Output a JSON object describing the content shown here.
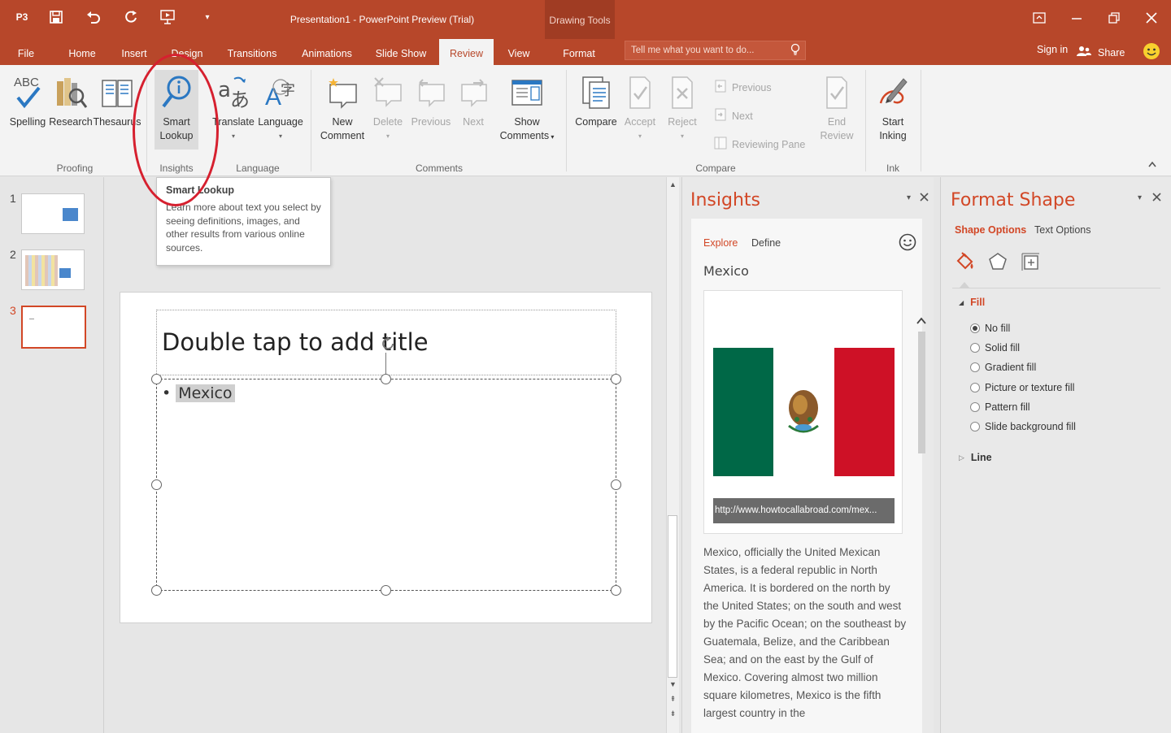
{
  "window": {
    "title": "Presentation1 - PowerPoint Preview (Trial)",
    "app_badge": "P3",
    "contextual_group": "Drawing Tools"
  },
  "tabs": [
    "File",
    "Home",
    "Insert",
    "Design",
    "Transitions",
    "Animations",
    "Slide Show",
    "Review",
    "View",
    "Format"
  ],
  "active_tab": "Review",
  "tell_me": {
    "placeholder": "Tell me what you want to do..."
  },
  "account": {
    "sign_in": "Sign in",
    "share": "Share"
  },
  "ribbon": {
    "proofing": {
      "label": "Proofing",
      "spelling": "Spelling",
      "research": "Research",
      "thesaurus": "Thesaurus",
      "abc": "ABC"
    },
    "insights": {
      "label": "Insights",
      "smart_lookup_line1": "Smart",
      "smart_lookup_line2": "Lookup"
    },
    "language": {
      "label": "Language",
      "translate": "Translate",
      "language": "Language"
    },
    "comments": {
      "label": "Comments",
      "new_line1": "New",
      "new_line2": "Comment",
      "delete": "Delete",
      "previous": "Previous",
      "next": "Next",
      "show_line1": "Show",
      "show_line2": "Comments"
    },
    "compare": {
      "label": "Compare",
      "compare": "Compare",
      "accept": "Accept",
      "reject": "Reject",
      "previous": "Previous",
      "next": "Next",
      "reviewing_pane": "Reviewing Pane",
      "end_line1": "End",
      "end_line2": "Review"
    },
    "ink": {
      "label": "Ink",
      "start_line1": "Start",
      "start_line2": "Inking"
    }
  },
  "tooltip": {
    "title": "Smart Lookup",
    "body": "Learn more about text you select by seeing definitions, images, and other results from various online sources."
  },
  "thumbnails": [
    {
      "num": "1"
    },
    {
      "num": "2"
    },
    {
      "num": "3"
    }
  ],
  "slide": {
    "title_placeholder": "Double tap to add title",
    "bullet": "•",
    "body_text": "Mexico"
  },
  "insights": {
    "title": "Insights",
    "tab_explore": "Explore",
    "tab_define": "Define",
    "topic": "Mexico",
    "image_url": "http://www.howtocallabroad.com/mex...",
    "description": "Mexico, officially the United Mexican States, is a federal republic in North America. It is bordered on the north by the United States; on the south and west by the Pacific Ocean; on the southeast by Guatemala, Belize, and the Caribbean Sea; and on the east by the Gulf of Mexico. Covering almost two million square kilometres, Mexico is the fifth largest country in the"
  },
  "format_shape": {
    "title": "Format Shape",
    "tab_shape": "Shape Options",
    "tab_text": "Text Options",
    "fill_label": "Fill",
    "line_label": "Line",
    "fill_options": [
      "No fill",
      "Solid fill",
      "Gradient fill",
      "Picture or texture fill",
      "Pattern fill",
      "Slide background fill"
    ],
    "selected_fill": "No fill"
  },
  "colors": {
    "accent": "#b7472a",
    "pane_title": "#d24726",
    "highlight": "#d6202f",
    "flag_green": "#006847",
    "flag_red": "#ce1126"
  }
}
